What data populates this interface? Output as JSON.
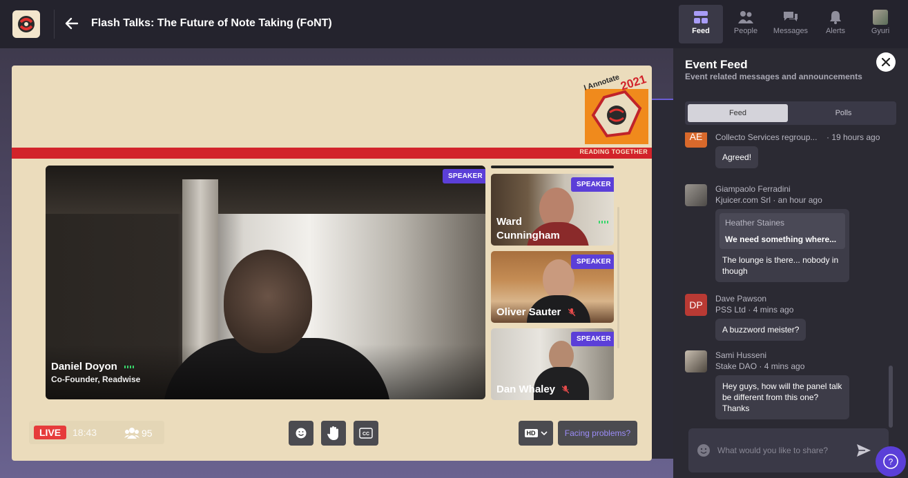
{
  "topbar": {
    "title": "Flash Talks: The Future of Note Taking (FoNT)"
  },
  "stage": {
    "banner_tagline": "READING TOGETHER",
    "banner_logo_text": "I Annotate 2021",
    "main_speaker": {
      "tag": "SPEAKER",
      "name": "Daniel Doyon",
      "role": "Co-Founder, Readwise"
    },
    "side_speakers": [
      {
        "tag": "SPEAKER",
        "name": "Ward Cunningham",
        "muted": false
      },
      {
        "tag": "SPEAKER",
        "name": "Oliver Sauter",
        "muted": true
      },
      {
        "tag": "SPEAKER",
        "name": "Dan Whaley",
        "muted": true
      }
    ]
  },
  "controls": {
    "live_label": "LIVE",
    "elapsed": "18:43",
    "viewers": "95",
    "hd_label": "HD",
    "facing_problems": "Facing problems?"
  },
  "panel": {
    "tabs": [
      {
        "label": "Feed",
        "icon": "feed-icon",
        "active": true
      },
      {
        "label": "People",
        "icon": "people-icon",
        "active": false
      },
      {
        "label": "Messages",
        "icon": "messages-icon",
        "active": false
      },
      {
        "label": "Alerts",
        "icon": "bell-icon",
        "active": false
      },
      {
        "label": "Gyuri",
        "icon": "user-avatar",
        "active": false
      }
    ],
    "title": "Event Feed",
    "subtitle": "Event related messages and announcements",
    "segments": [
      "Feed",
      "Polls"
    ],
    "messages": [
      {
        "initials": "AE",
        "avatar_color": "#d9692b",
        "name": "Collecto Services regroup...",
        "meta": "· 19 hours ago",
        "text": "Agreed!"
      },
      {
        "initials": "",
        "avatar_color": "#6d6a66",
        "name": "Giampaolo Ferradini",
        "meta": "Kjuicer.com Srl · an hour ago",
        "quote_name": "Heather Staines",
        "quote_text": "We need something where...",
        "text": "The lounge is there... nobody in though"
      },
      {
        "initials": "DP",
        "avatar_color": "#b93a34",
        "name": "Dave Pawson",
        "meta": "PSS Ltd · 4 mins ago",
        "text": "A buzzword meister?"
      },
      {
        "initials": "",
        "avatar_color": "#7a7064",
        "name": "Sami Husseni",
        "meta": "Stake DAO · 4 mins ago",
        "text": "Hey guys, how will the panel talk be different from this one? Thanks"
      }
    ],
    "composer_placeholder": "What would you like to share?",
    "help_label": "?"
  }
}
